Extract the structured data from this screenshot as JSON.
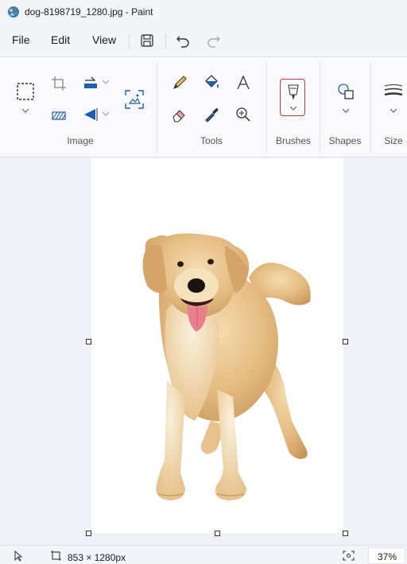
{
  "window": {
    "title": "dog-8198719_1280.jpg - Paint"
  },
  "menu": {
    "file": "File",
    "edit": "Edit",
    "view": "View"
  },
  "ribbon": {
    "groups": {
      "image": "Image",
      "tools": "Tools",
      "brushes": "Brushes",
      "shapes": "Shapes",
      "size": "Size"
    },
    "colors": {
      "accent": "#1e5fb4",
      "brush_selected_border": "#c03a3a"
    }
  },
  "status": {
    "dimensions": "853 × 1280px",
    "zoom": "37%"
  }
}
